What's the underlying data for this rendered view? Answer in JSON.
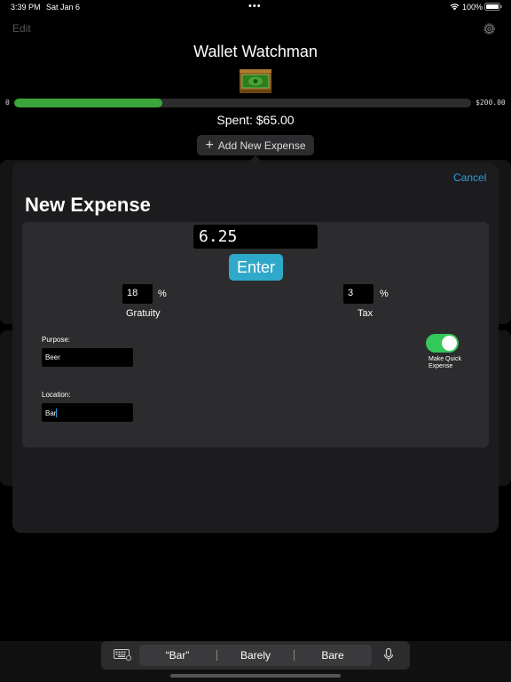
{
  "status_bar": {
    "time": "3:39 PM",
    "date": "Sat Jan 6",
    "dots": "•••",
    "battery_percent": "100%"
  },
  "header": {
    "edit_label": "Edit",
    "title": "Wallet Watchman",
    "settings_icon": "gear-icon",
    "wallet_icon": "wallet-icon"
  },
  "budget": {
    "min_label": "0",
    "max_label": "$200.00",
    "progress_fraction": 0.325,
    "progress_color": "#3aa53a",
    "spent_label": "Spent: $65.00",
    "add_button_label": "Add New Expense"
  },
  "sheet": {
    "cancel_label": "Cancel",
    "title": "New Expense",
    "amount_value": "6.25",
    "enter_label": "Enter",
    "gratuity_value": "18",
    "gratuity_pct": "%",
    "gratuity_caption": "Gratuity",
    "tax_value": "3",
    "tax_pct": "%",
    "tax_caption": "Tax",
    "purpose_label": "Purpose:",
    "purpose_value": "Beer",
    "location_label": "Location:",
    "location_value": "Bar",
    "quick_expense_label": "Make Quick Expense",
    "quick_expense_on": true,
    "accent_color": "#2fa9c9",
    "toggle_color": "#34c759"
  },
  "keyboard": {
    "suggestions": [
      "“Bar”",
      "Barely",
      "Bare"
    ]
  }
}
